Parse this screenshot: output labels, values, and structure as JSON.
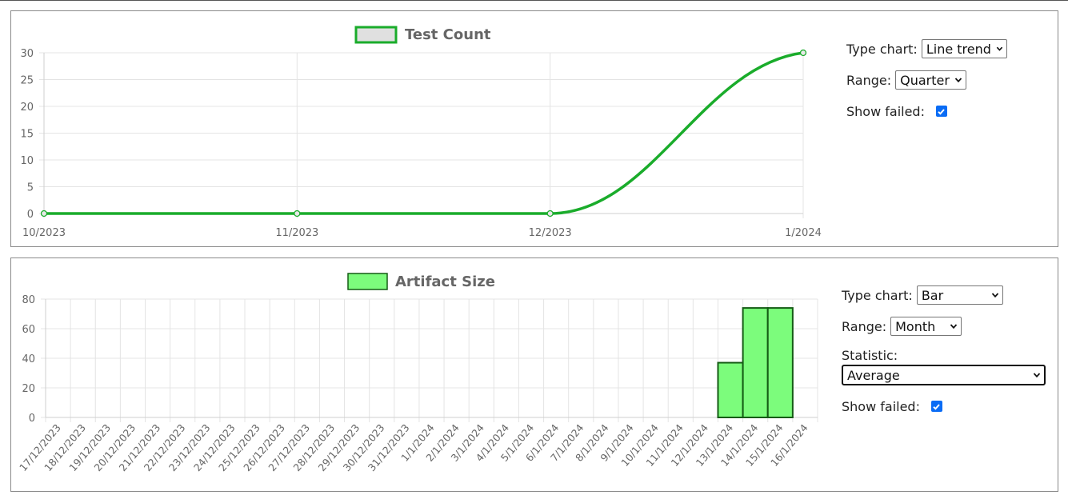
{
  "charts": [
    {
      "chart_data": {
        "type": "line",
        "title": "Test Count",
        "categories": [
          "10/2023",
          "11/2023",
          "12/2023",
          "1/2024"
        ],
        "series": [
          {
            "name": "Test Count",
            "values": [
              0,
              0,
              0,
              30
            ]
          }
        ],
        "yticks": [
          0,
          5,
          10,
          15,
          20,
          25,
          30
        ],
        "ylim": [
          0,
          30
        ],
        "grid": true,
        "legend": "top-center",
        "color": "#1aac2b"
      },
      "controls": {
        "type_label": "Type chart:",
        "type_value": "Line trend",
        "range_label": "Range:",
        "range_value": "Quarter",
        "show_failed_label": "Show failed:",
        "show_failed": true
      }
    },
    {
      "chart_data": {
        "type": "bar",
        "title": "Artifact Size",
        "categories": [
          "17/12/2023",
          "18/12/2023",
          "19/12/2023",
          "20/12/2023",
          "21/12/2023",
          "22/12/2023",
          "23/12/2023",
          "24/12/2023",
          "25/12/2023",
          "26/12/2023",
          "27/12/2023",
          "28/12/2023",
          "29/12/2023",
          "30/12/2023",
          "31/12/2023",
          "1/1/2024",
          "2/1/2024",
          "3/1/2024",
          "4/1/2024",
          "5/1/2024",
          "6/1/2024",
          "7/1/2024",
          "8/1/2024",
          "9/1/2024",
          "10/1/2024",
          "11/1/2024",
          "12/1/2024",
          "13/1/2024",
          "14/1/2024",
          "15/1/2024",
          "16/1/2024"
        ],
        "series": [
          {
            "name": "Artifact Size",
            "values": [
              0,
              0,
              0,
              0,
              0,
              0,
              0,
              0,
              0,
              0,
              0,
              0,
              0,
              0,
              0,
              0,
              0,
              0,
              0,
              0,
              0,
              0,
              0,
              0,
              0,
              0,
              0,
              37,
              74,
              74,
              0
            ]
          }
        ],
        "yticks": [
          0,
          20,
          40,
          60,
          80
        ],
        "ylim": [
          0,
          80
        ],
        "grid": true,
        "legend": "top-center",
        "color": "#7cfc7c",
        "border_color": "#155c15"
      },
      "controls": {
        "type_label": "Type chart:",
        "type_value": "Bar",
        "range_label": "Range:",
        "range_value": "Month",
        "statistic_label": "Statistic:",
        "statistic_value": "Average",
        "show_failed_label": "Show failed:",
        "show_failed": true
      }
    }
  ]
}
